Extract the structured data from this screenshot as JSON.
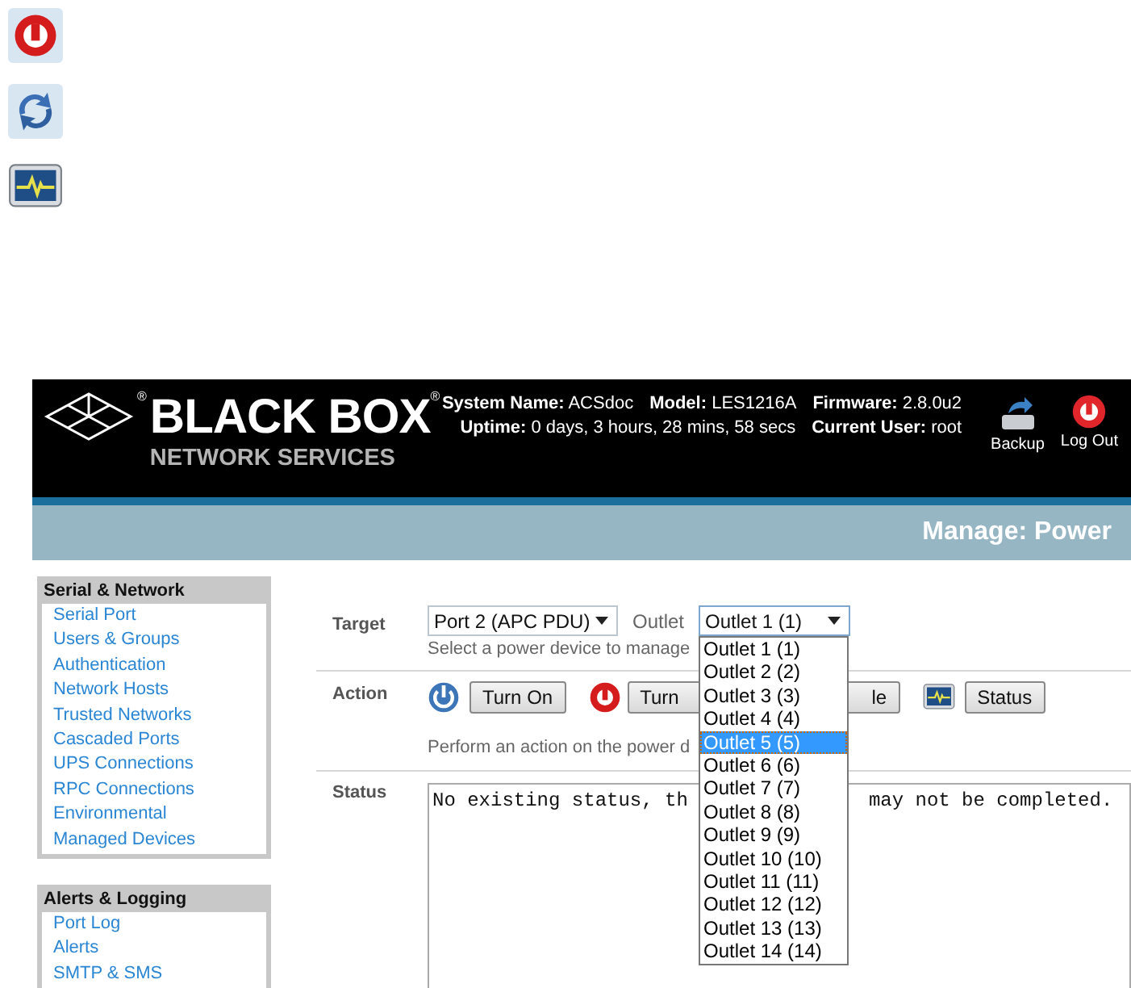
{
  "doc_icons": [
    {
      "kind": "power-off"
    },
    {
      "kind": "cycle"
    },
    {
      "kind": "status"
    }
  ],
  "header": {
    "logo": {
      "emblem_mark": "®",
      "title": "BLACK BOX",
      "title_mark": "®",
      "subtitle": "NETWORK SERVICES"
    },
    "info": [
      [
        {
          "label": "System Name:",
          "value": "ACSdoc"
        },
        {
          "label": "Model:",
          "value": "LES1216A"
        },
        {
          "label": "Firmware:",
          "value": "2.8.0u2"
        }
      ],
      [
        {
          "label": "Uptime:",
          "value": "0 days, 3 hours, 28 mins, 58 secs"
        },
        {
          "label": "Current User:",
          "value": "root"
        }
      ]
    ],
    "actions": [
      {
        "kind": "backup",
        "label": "Backup"
      },
      {
        "kind": "logout",
        "label": "Log Out"
      }
    ]
  },
  "page_title": "Manage: Power",
  "sidebar": {
    "sections": [
      {
        "title": "Serial & Network",
        "items": [
          "Serial Port",
          "Users & Groups",
          "Authentication",
          "Network Hosts",
          "Trusted Networks",
          "Cascaded Ports",
          "UPS Connections",
          "RPC Connections",
          "Environmental",
          "Managed Devices"
        ]
      },
      {
        "title": "Alerts & Logging",
        "items": [
          "Port Log",
          "Alerts",
          "SMTP & SMS"
        ]
      }
    ]
  },
  "form": {
    "target": {
      "label": "Target",
      "device": "Port 2 (APC PDU)",
      "outlet_label": "Outlet",
      "outlet": "Outlet 1 (1)",
      "hint": "Select a power device to manage"
    },
    "action": {
      "label": "Action",
      "buttons": [
        {
          "kind": "on",
          "label": "Turn On"
        },
        {
          "kind": "off",
          "label": "Turn"
        },
        {
          "kind": "cycle",
          "label": "le"
        },
        {
          "kind": "status",
          "label": "Status"
        }
      ],
      "hint": "Perform an action on the power d"
    },
    "status": {
      "label": "Status",
      "text_start": "No existing status, th",
      "text_end": "may not be completed."
    }
  },
  "outlet_dropdown": {
    "options": [
      {
        "label": "Outlet 1 (1)",
        "selected": false
      },
      {
        "label": "Outlet 2 (2)",
        "selected": false
      },
      {
        "label": "Outlet 3 (3)",
        "selected": false
      },
      {
        "label": "Outlet 4 (4)",
        "selected": false
      },
      {
        "label": "Outlet 5 (5)",
        "selected": true
      },
      {
        "label": "Outlet 6 (6)",
        "selected": false
      },
      {
        "label": "Outlet 7 (7)",
        "selected": false
      },
      {
        "label": "Outlet 8 (8)",
        "selected": false
      },
      {
        "label": "Outlet 9 (9)",
        "selected": false
      },
      {
        "label": "Outlet 10 (10)",
        "selected": false
      },
      {
        "label": "Outlet 11 (11)",
        "selected": false
      },
      {
        "label": "Outlet 12 (12)",
        "selected": false
      },
      {
        "label": "Outlet 13 (13)",
        "selected": false
      },
      {
        "label": "Outlet 14 (14)",
        "selected": false
      }
    ]
  }
}
